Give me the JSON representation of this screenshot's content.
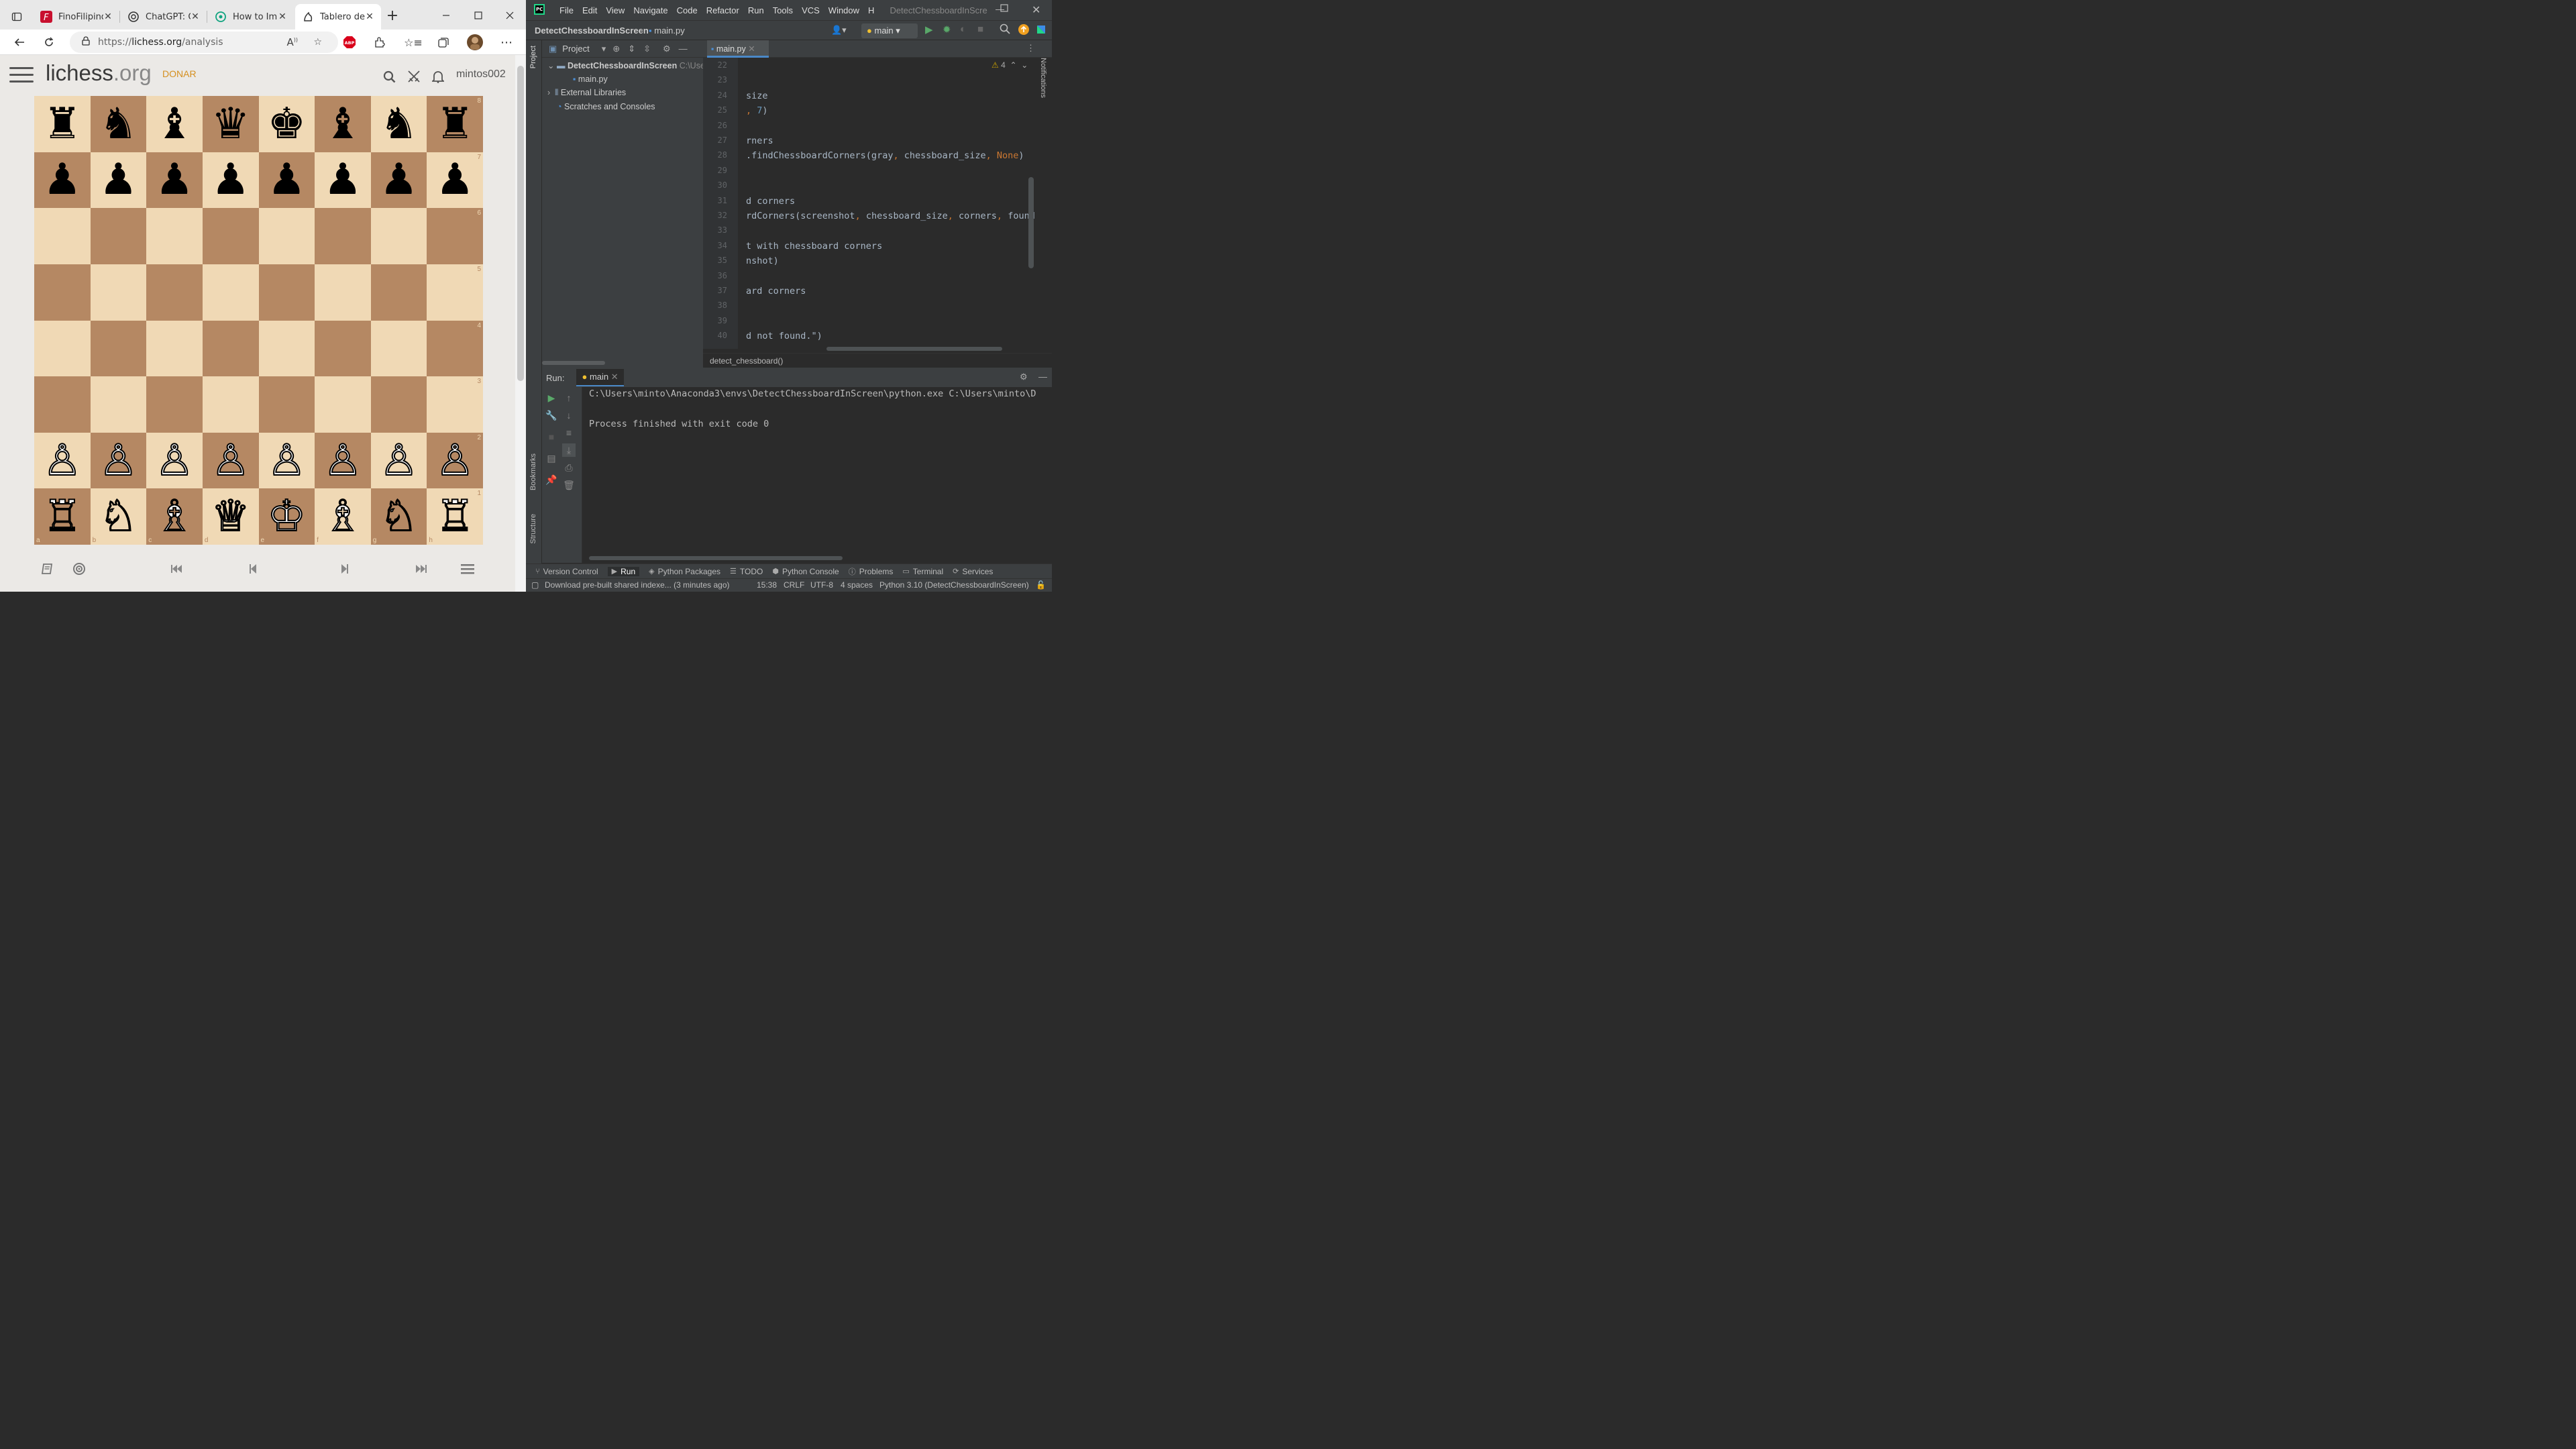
{
  "browser": {
    "tabs": [
      {
        "title": "FinoFilipino",
        "icon": "fino-icon"
      },
      {
        "title": "ChatGPT: O",
        "icon": "chatgpt-icon"
      },
      {
        "title": "How to Imp",
        "icon": "openai-icon"
      },
      {
        "title": "Tablero de",
        "icon": "lichess-icon"
      }
    ],
    "url_prefix": "https://",
    "url_domain": "lichess.org",
    "url_path": "/analysis",
    "adblock_label": "ABP"
  },
  "lichess": {
    "logo_main": "lichess",
    "logo_suffix": ".org",
    "donate_label": "DONAR",
    "username": "mintos002",
    "ranks": [
      "8",
      "7",
      "6",
      "5",
      "4",
      "3",
      "2",
      "1"
    ],
    "files": [
      "a",
      "b",
      "c",
      "d",
      "e",
      "f",
      "g",
      "h"
    ],
    "position": [
      [
        "♜",
        "♞",
        "♝",
        "♛",
        "♚",
        "♝",
        "♞",
        "♜"
      ],
      [
        "♟",
        "♟",
        "♟",
        "♟",
        "♟",
        "♟",
        "♟",
        "♟"
      ],
      [
        "",
        "",
        "",
        "",
        "",
        "",
        "",
        ""
      ],
      [
        "",
        "",
        "",
        "",
        "",
        "",
        "",
        ""
      ],
      [
        "",
        "",
        "",
        "",
        "",
        "",
        "",
        ""
      ],
      [
        "",
        "",
        "",
        "",
        "",
        "",
        "",
        ""
      ],
      [
        "♙",
        "♙",
        "♙",
        "♙",
        "♙",
        "♙",
        "♙",
        "♙"
      ],
      [
        "♖",
        "♘",
        "♗",
        "♕",
        "♔",
        "♗",
        "♘",
        "♖"
      ]
    ],
    "colors": {
      "light_square": "#f0d9b5",
      "dark_square": "#b58863",
      "accent": "#d59020"
    }
  },
  "ide": {
    "project_name": "DetectChessboardInScreen",
    "window_title": "DetectChessboardInScre",
    "menu": [
      "File",
      "Edit",
      "View",
      "Navigate",
      "Code",
      "Refactor",
      "Run",
      "Tools",
      "VCS",
      "Window",
      "H"
    ],
    "breadcrumb_file": "main.py",
    "run_config": "main",
    "project_panel_title": "Project",
    "tree": {
      "root": "DetectChessboardInScreen",
      "root_path": "C:\\Use",
      "file": "main.py",
      "external": "External Libraries",
      "scratches": "Scratches and Consoles"
    },
    "editor_tab": "main.py",
    "warning_count": "4",
    "code_lines": [
      {
        "n": "22",
        "text": ""
      },
      {
        "n": "23",
        "text": ""
      },
      {
        "n": "24",
        "text": "size"
      },
      {
        "n": "25",
        "text": ", 7)"
      },
      {
        "n": "26",
        "text": ""
      },
      {
        "n": "27",
        "text": "rners"
      },
      {
        "n": "28",
        "text": ".findChessboardCorners(gray, chessboard_size, None)"
      },
      {
        "n": "29",
        "text": ""
      },
      {
        "n": "30",
        "text": ""
      },
      {
        "n": "31",
        "text": "d corners"
      },
      {
        "n": "32",
        "text": "rdCorners(screenshot, chessboard_size, corners, found"
      },
      {
        "n": "33",
        "text": ""
      },
      {
        "n": "34",
        "text": "t with chessboard corners"
      },
      {
        "n": "35",
        "text": "nshot)"
      },
      {
        "n": "36",
        "text": ""
      },
      {
        "n": "37",
        "text": "ard corners"
      },
      {
        "n": "38",
        "text": ""
      },
      {
        "n": "39",
        "text": ""
      },
      {
        "n": "40",
        "text": "d not found.\")"
      }
    ],
    "function_breadcrumb": "detect_chessboard()",
    "run_label": "Run:",
    "run_tab": "main",
    "output": [
      "C:\\Users\\minto\\Anaconda3\\envs\\DetectChessboardInScreen\\python.exe C:\\Users\\minto\\D",
      "",
      "Process finished with exit code 0"
    ],
    "tool_tabs": [
      "Version Control",
      "Run",
      "Python Packages",
      "TODO",
      "Python Console",
      "Problems",
      "Terminal",
      "Services"
    ],
    "side_labels": {
      "project": "Project",
      "bookmarks": "Bookmarks",
      "structure": "Structure",
      "notifications": "Notifications"
    },
    "status": {
      "message": "Download pre-built shared indexe... (3 minutes ago)",
      "position": "15:38",
      "line_sep": "CRLF",
      "encoding": "UTF-8",
      "indent": "4 spaces",
      "interpreter": "Python 3.10 (DetectChessboardInScreen)"
    }
  }
}
